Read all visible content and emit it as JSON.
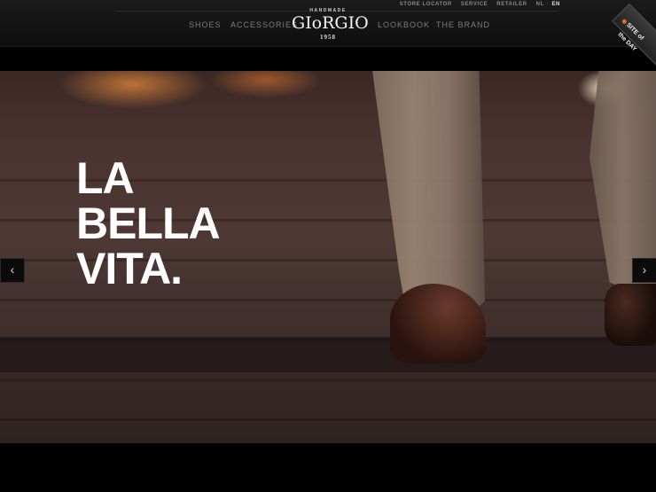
{
  "header": {
    "util_nav": {
      "store_locator": "STORE LOCATOR",
      "service": "SERVICE",
      "retailer": "RETAILER",
      "lang_nl": "NL",
      "lang_sep": "·",
      "lang_en": "EN"
    },
    "nav": {
      "shoes": "SHOES",
      "accessories": "ACCESSORIES",
      "lookbook": "LOOKBOOK",
      "brand": "THE BRAND"
    },
    "logo": {
      "handmade": "HANDMADE",
      "name": "GIoRGIO",
      "year": "1958"
    },
    "badge": {
      "line1": "SITE of",
      "line2": "the DAY"
    }
  },
  "hero": {
    "headline_line1": "LA",
    "headline_line2": "BELLA",
    "headline_line3": "VITA.",
    "prev_icon": "chevron-left",
    "next_icon": "chevron-right",
    "prev_glyph": "‹",
    "next_glyph": "›"
  },
  "colors": {
    "header_bg": "#141414",
    "text_nav": "#7d7d7d",
    "headline": "#ffffff",
    "badge_accent": "#e86a2a"
  }
}
